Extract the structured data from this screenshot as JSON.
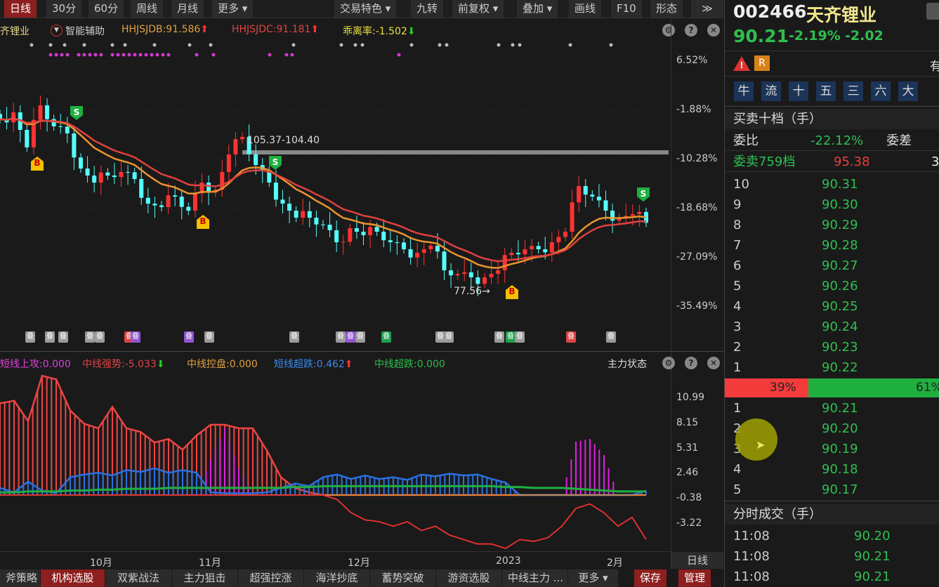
{
  "toolbar": {
    "left": [
      "日线",
      "30分",
      "60分",
      "周线",
      "月线",
      "更多 ▾"
    ],
    "right": [
      "交易特色 ▾",
      "九转",
      "前复权 ▾",
      "叠加 ▾",
      "画线",
      "F10",
      "形态",
      "≫"
    ],
    "active": "日线"
  },
  "main_header": {
    "stock_short": "齐锂业",
    "assist": "智能辅助",
    "hhjsjdb": "HHJSJDB:91.586",
    "hhjsjdc": "HHJSJDC:91.181",
    "deviation": "乖离率:-1.502"
  },
  "price_axis": [
    "6.52%",
    "-1.88%",
    "-10.28%",
    "-18.68%",
    "-27.09%",
    "-35.49%"
  ],
  "annotations": {
    "high_range": "105.37-104.40",
    "low": "77.56→"
  },
  "badge_glyph": "叠",
  "sub_header": {
    "short_attack": "短线上攻:0.000",
    "mid_strength": "中线强势:-5.033",
    "mid_control": "中线控盘:0.000",
    "short_oversold": "短线超跌:0.462",
    "mid_oversold": "中线超跌:0.000",
    "state": "主力状态"
  },
  "sub_axis": [
    "10.99",
    "8.15",
    "5.31",
    "2.46",
    "-0.38",
    "-3.22"
  ],
  "x_axis": [
    "10月",
    "11月",
    "12月",
    "2023",
    "2月"
  ],
  "period_label": "日线",
  "bottom_tabs": [
    "斧策略",
    "机构选股",
    "双紫战法",
    "主力狙击",
    "超强控涨",
    "海洋抄底",
    "蓄势突破",
    "游资选股",
    "中线主力 ...",
    "更多 ▾"
  ],
  "bottom_active": "机构选股",
  "bottom_right": [
    "保存",
    "管理"
  ],
  "quote": {
    "code": "002466",
    "name": "天齐锂业",
    "price": "90.21",
    "pct": "-2.19%",
    "change": "-2.02",
    "badge_r": "R",
    "right_cut": "有"
  },
  "cat_buttons": [
    "牛",
    "流",
    "十",
    "五",
    "三",
    "六",
    "大"
  ],
  "orderbook": {
    "title": "买卖十档（手）",
    "weibi_label": "委比",
    "weibi": "-22.12%",
    "weicha_label": "委差",
    "weicha_cut": "3",
    "sell_levels_label": "委卖759档",
    "sell_levels_price": "95.38",
    "asks": [
      [
        "10",
        "90.31"
      ],
      [
        "9",
        "90.30"
      ],
      [
        "8",
        "90.29"
      ],
      [
        "7",
        "90.28"
      ],
      [
        "6",
        "90.27"
      ],
      [
        "5",
        "90.26"
      ],
      [
        "4",
        "90.25"
      ],
      [
        "3",
        "90.24"
      ],
      [
        "2",
        "90.23"
      ],
      [
        "1",
        "90.22"
      ]
    ],
    "buy_pct": "39%",
    "sell_pct": "61%",
    "buy_pct_value": 39,
    "bids": [
      [
        "1",
        "90.21"
      ],
      [
        "2",
        "90.20"
      ],
      [
        "3",
        "90.19"
      ],
      [
        "4",
        "90.18"
      ],
      [
        "5",
        "90.17"
      ]
    ]
  },
  "trades": {
    "title": "分时成交（手）",
    "rows": [
      [
        "11:08",
        "90.20"
      ],
      [
        "11:08",
        "90.21"
      ],
      [
        "11:08",
        "90.21"
      ]
    ]
  },
  "colors": {
    "up": "#ff3232",
    "down": "#54ffff",
    "ma1": "#e8952f",
    "ma2": "#e0413f",
    "accent": "#8e1f1f"
  },
  "chart_data": [
    {
      "type": "candlestick",
      "closes": [
        109.25,
        110.54,
        104.08,
        111.84,
        107.96,
        106.66,
        100.2,
        97.61,
        98.91,
        99.55,
        98.26,
        93.73,
        93.09,
        95.03,
        92.44,
        97.61,
        96.32,
        102.78,
        106.02,
        100.84,
        97.61,
        93.73,
        91.15,
        91.15,
        89.85,
        86.62,
        89.21,
        87.91,
        88.56,
        86.62,
        85.33,
        84.68,
        85.98,
        81.45,
        80.8,
        80.16,
        80.16,
        81.45,
        84.68,
        85.33,
        85.33,
        86.62,
        88.56,
        96.97,
        95.03,
        92.44,
        91.15,
        91.79,
        90.21
      ],
      "ylim": [
        72,
        121
      ],
      "last": 90.21
    },
    {
      "type": "bar",
      "name": "主力状态",
      "red": [
        10.3,
        10.6,
        8.3,
        13.4,
        13.0,
        9.5,
        8.0,
        7.5,
        9.9,
        7.5,
        7.1,
        5.9,
        6.3,
        5.1,
        6.7,
        7.9,
        7.9,
        7.5,
        7.5,
        5.0,
        2.0,
        0.8,
        0.3,
        0,
        0,
        0,
        0,
        0,
        0,
        0,
        0,
        0,
        0,
        0,
        0,
        0,
        0,
        0,
        0,
        0,
        0,
        0,
        0,
        0,
        0,
        0,
        0
      ],
      "magenta": [
        0,
        0,
        0,
        0,
        0,
        0,
        0,
        0,
        0,
        0,
        0,
        0,
        0,
        0,
        0,
        4.0,
        7.5,
        3.0,
        0,
        0,
        0,
        0,
        0,
        0,
        0,
        0,
        0,
        0,
        0,
        0,
        0,
        0,
        0,
        0,
        0,
        0,
        0,
        0,
        0,
        0,
        0,
        6.0,
        6.3,
        4.5,
        0,
        0,
        0
      ],
      "blue": [
        0.8,
        0.3,
        1.5,
        0.5,
        0.2,
        2.0,
        2.3,
        2.5,
        2.2,
        2.8,
        2.6,
        3.0,
        2.5,
        2.8,
        2.5,
        0.3,
        0.2,
        0.2,
        0.2,
        0.3,
        0.8,
        1.3,
        1.0,
        2.0,
        2.3,
        1.8,
        2.2,
        1.8,
        2.0,
        1.7,
        2.3,
        2.1,
        2.4,
        2.2,
        2.3,
        1.8,
        1.4,
        0,
        0,
        0,
        0,
        0,
        0,
        0,
        0,
        0,
        0.5
      ],
      "green_line": [
        0.3,
        0.3,
        0.4,
        0.4,
        0.4,
        0.5,
        0.5,
        0.6,
        0.6,
        0.7,
        0.7,
        0.7,
        0.8,
        0.8,
        0.8,
        0.8,
        0.8,
        0.8,
        0.8,
        0.8,
        0.8,
        0.9,
        0.9,
        1.0,
        1.0,
        1.0,
        1.0,
        1.0,
        1.0,
        1.0,
        1.0,
        1.0,
        1.0,
        1.0,
        1.0,
        1.0,
        0.9,
        0.9,
        0.8,
        0.8,
        0.8,
        0.7,
        0.6,
        0.5,
        0.4,
        0.4,
        0.4
      ],
      "red_line": [
        0,
        0,
        0,
        0,
        0,
        0,
        0,
        0,
        0,
        0,
        0,
        0,
        0,
        0,
        0,
        0,
        0,
        0,
        0,
        0,
        0,
        0,
        0,
        0,
        -0.5,
        -2.0,
        -2.8,
        -3.0,
        -3.5,
        -3.0,
        -4.0,
        -3.5,
        -4.5,
        -5.0,
        -5.5,
        -5.5,
        -6.0,
        -5.0,
        -5.2,
        -4.8,
        -3.5,
        -1.5,
        -1.0,
        -2.0,
        -3.5,
        -2.5,
        -5.0
      ],
      "ylim": [
        -6.5,
        14.5
      ]
    }
  ]
}
